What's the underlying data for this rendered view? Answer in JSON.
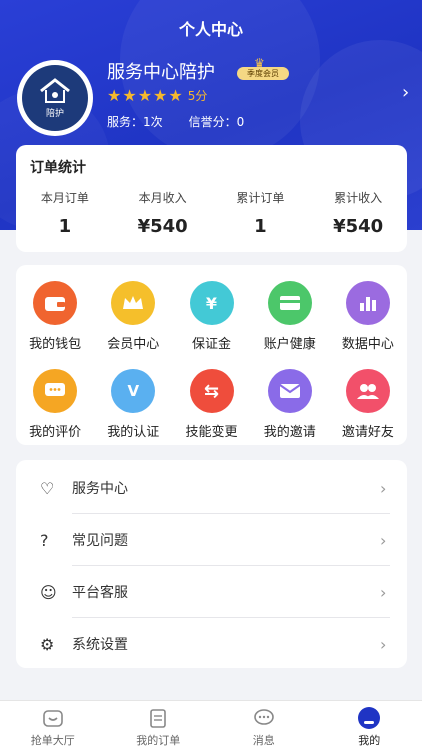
{
  "header": {
    "title": "个人中心",
    "user_name": "服务中心陪护",
    "vip_label": "季度会员",
    "rating_score": "5分",
    "stars": 5,
    "service_count": "服务：1次",
    "credit_score": "信誉分：0",
    "avatar_text": "陪护"
  },
  "order_stats": {
    "title": "订单统计",
    "items": [
      {
        "label": "本月订单",
        "value": "1"
      },
      {
        "label": "本月收入",
        "value": "¥540"
      },
      {
        "label": "累计订单",
        "value": "1"
      },
      {
        "label": "累计收入",
        "value": "¥540"
      }
    ]
  },
  "features": [
    {
      "label": "我的钱包",
      "icon": "wallet-icon",
      "color": "#f0642f"
    },
    {
      "label": "会员中心",
      "icon": "crown-icon",
      "color": "#f5bf2b"
    },
    {
      "label": "保证金",
      "icon": "yen-shield-icon",
      "color": "#43c9d6"
    },
    {
      "label": "账户健康",
      "icon": "card-icon",
      "color": "#4cc76a"
    },
    {
      "label": "数据中心",
      "icon": "bar-chart-icon",
      "color": "#9b6be0"
    },
    {
      "label": "我的评价",
      "icon": "comment-icon",
      "color": "#f5a623"
    },
    {
      "label": "我的认证",
      "icon": "verified-icon",
      "color": "#5ab0f0"
    },
    {
      "label": "技能变更",
      "icon": "swap-icon",
      "color": "#ef4d3c"
    },
    {
      "label": "我的邀请",
      "icon": "mail-icon",
      "color": "#8a6be8"
    },
    {
      "label": "邀请好友",
      "icon": "friends-icon",
      "color": "#f2506a"
    }
  ],
  "menu": [
    {
      "label": "服务中心",
      "icon": "heart-hand-icon"
    },
    {
      "label": "常见问题",
      "icon": "question-icon"
    },
    {
      "label": "平台客服",
      "icon": "chat-smile-icon"
    },
    {
      "label": "系统设置",
      "icon": "gear-icon"
    }
  ],
  "tabbar": [
    {
      "label": "抢单大厅",
      "icon": "hall-icon",
      "active": false
    },
    {
      "label": "我的订单",
      "icon": "order-list-icon",
      "active": false
    },
    {
      "label": "消息",
      "icon": "message-icon",
      "active": false
    },
    {
      "label": "我的",
      "icon": "profile-icon",
      "active": true
    }
  ],
  "colors": {
    "brand": "#1f34c4",
    "star": "#f5b82e",
    "background": "#f2f3f7"
  }
}
